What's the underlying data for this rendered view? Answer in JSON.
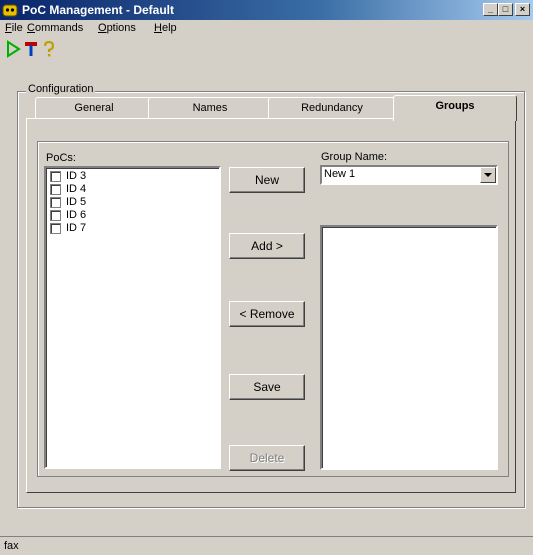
{
  "window": {
    "title": "PoC Management - Default",
    "controls": {
      "minimize": "_",
      "maximize": "□",
      "close": "×"
    }
  },
  "menu": {
    "items": [
      {
        "label": "ile",
        "accel": "F"
      },
      {
        "label": "ommands",
        "accel": "C"
      },
      {
        "label": "ptions",
        "accel": "O"
      },
      {
        "label": "elp",
        "accel": "H"
      }
    ]
  },
  "toolbar": {
    "icons": [
      "play-icon",
      "tools-icon",
      "help-icon"
    ],
    "colors": {
      "play": "#00b000",
      "tools": "#c00000",
      "help": "#c0a000"
    }
  },
  "config": {
    "group_label": "Configuration",
    "tabs": [
      {
        "label": "General",
        "active": false
      },
      {
        "label": "Names",
        "active": false
      },
      {
        "label": "Redundancy",
        "active": false
      },
      {
        "label": "Groups",
        "active": true
      }
    ]
  },
  "groups": {
    "pocs_label": "PoCs:",
    "pocs": [
      "ID 3",
      "ID 4",
      "ID 5",
      "ID 6",
      "ID 7"
    ],
    "group_name_label": "Group Name:",
    "group_name_value": "New 1",
    "buttons": {
      "new": "New",
      "add": "Add >",
      "remove": "< Remove",
      "save": "Save",
      "delete": "Delete"
    }
  },
  "status": {
    "text": "fax"
  }
}
